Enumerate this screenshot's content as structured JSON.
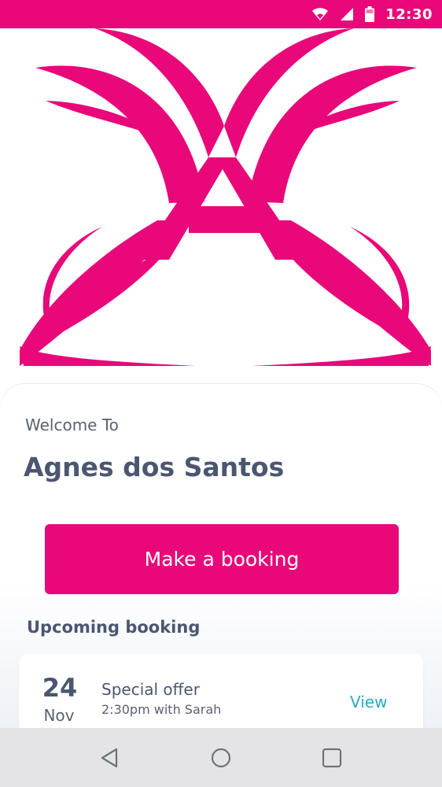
{
  "status_bar": {
    "time": "12:30",
    "icons": [
      "wifi-icon",
      "signal-icon",
      "battery-icon"
    ]
  },
  "logo": {
    "icon": "butterfly-a-logo",
    "color": "#e8087a"
  },
  "welcome": {
    "label": "Welcome To",
    "business_name": "Agnes dos Santos"
  },
  "booking_button": {
    "label": "Make a booking"
  },
  "upcoming": {
    "section_title": "Upcoming booking",
    "items": [
      {
        "day": "24",
        "month": "Nov",
        "title": "Special offer",
        "subtitle": "2:30pm with Sarah",
        "action": "View"
      }
    ]
  },
  "nav": {
    "icons": [
      "back-icon",
      "home-icon",
      "recents-icon"
    ]
  },
  "colors": {
    "brand": "#e8087a",
    "text_dark": "#4b5670",
    "link": "#2aa8c4",
    "nav_bg": "#e4e4e7"
  }
}
